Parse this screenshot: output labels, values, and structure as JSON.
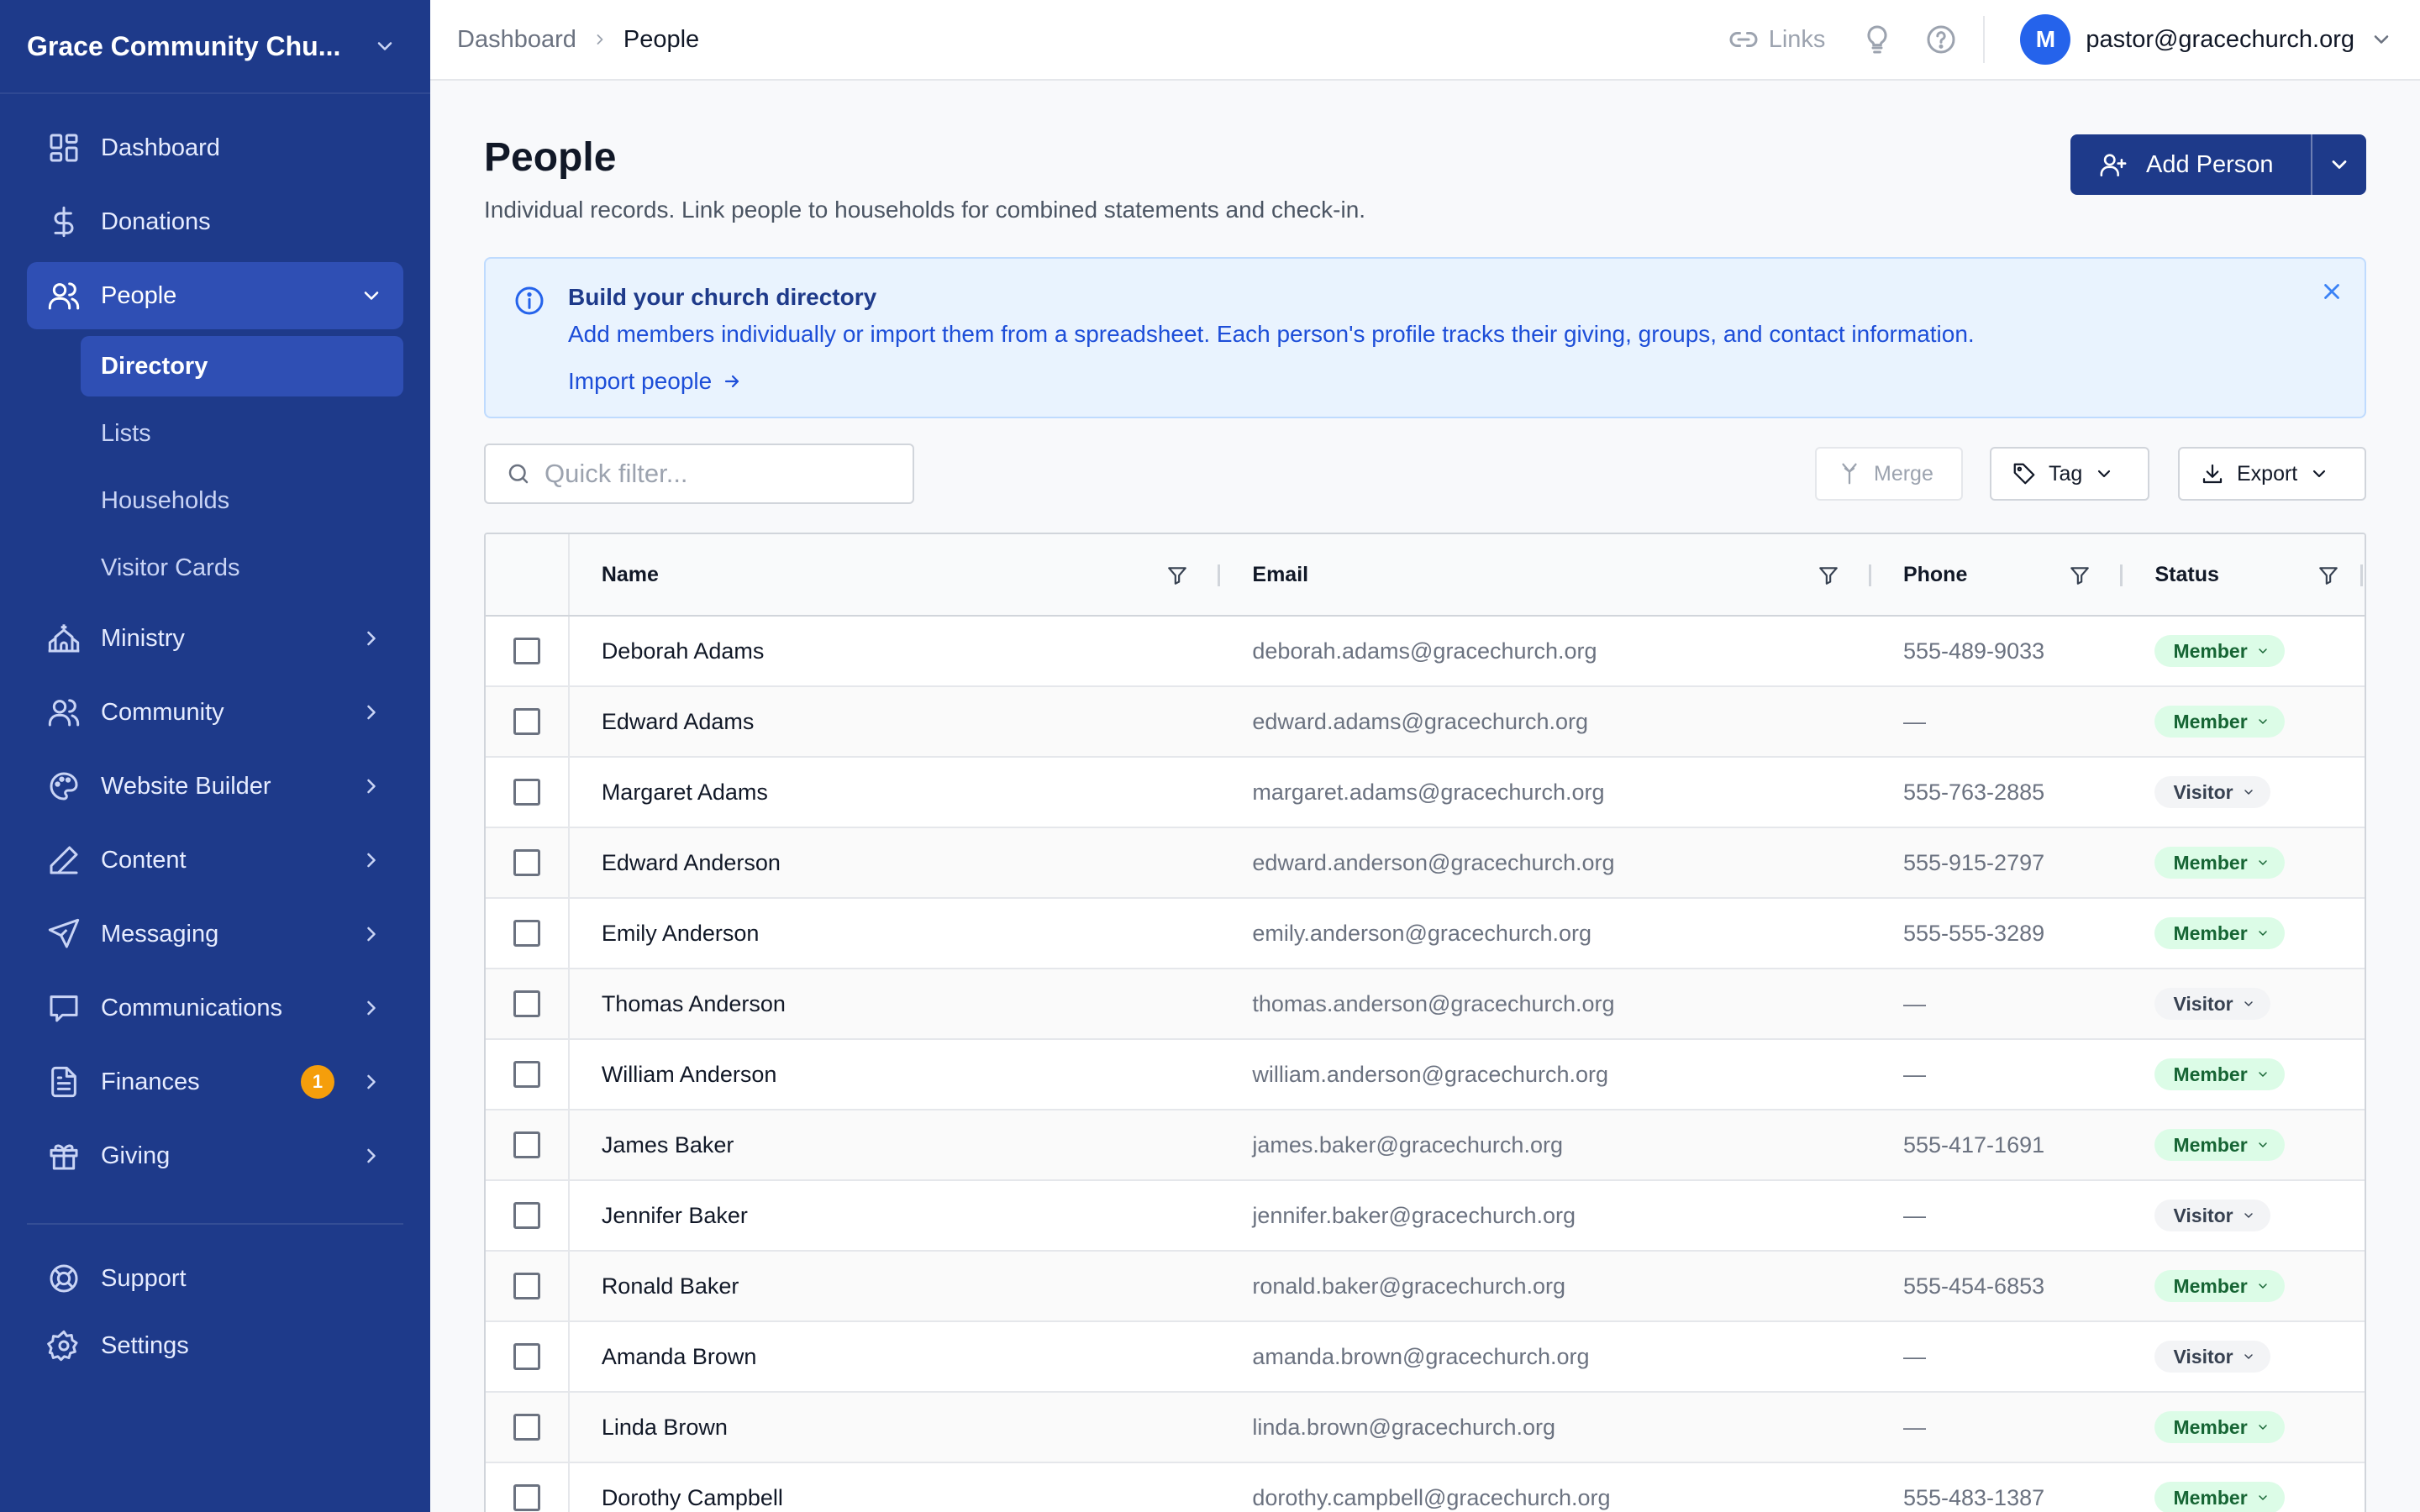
{
  "org": {
    "name": "Grace Community Chu..."
  },
  "sidebar": {
    "items": [
      {
        "label": "Dashboard",
        "icon": "grid-icon"
      },
      {
        "label": "Donations",
        "icon": "dollar-icon"
      },
      {
        "label": "People",
        "icon": "users-icon"
      },
      {
        "label": "Ministry",
        "icon": "church-icon"
      },
      {
        "label": "Community",
        "icon": "users-icon"
      },
      {
        "label": "Website Builder",
        "icon": "palette-icon"
      },
      {
        "label": "Content",
        "icon": "pen-icon"
      },
      {
        "label": "Messaging",
        "icon": "send-icon"
      },
      {
        "label": "Communications",
        "icon": "message-square-icon"
      },
      {
        "label": "Finances",
        "icon": "file-text-icon",
        "badge": "1"
      },
      {
        "label": "Giving",
        "icon": "gift-icon"
      }
    ],
    "people_sub": [
      "Directory",
      "Lists",
      "Households",
      "Visitor Cards"
    ],
    "footer": [
      {
        "label": "Support",
        "icon": "lifebuoy-icon"
      },
      {
        "label": "Settings",
        "icon": "gear-icon"
      }
    ]
  },
  "topbar": {
    "breadcrumb": [
      "Dashboard",
      "People"
    ],
    "links_label": "Links",
    "avatar_initial": "M",
    "user_email": "pastor@gracechurch.org"
  },
  "page": {
    "title": "People",
    "subtitle": "Individual records. Link people to households for combined statements and check-in.",
    "add_button": "Add Person"
  },
  "banner": {
    "title": "Build your church directory",
    "text": "Add members individually or import them from a spreadsheet. Each person's profile tracks their giving, groups, and contact information.",
    "link": "Import people"
  },
  "toolbar": {
    "filter_placeholder": "Quick filter...",
    "merge_label": "Merge",
    "tag_label": "Tag",
    "export_label": "Export"
  },
  "table": {
    "columns": [
      "Name",
      "Email",
      "Phone",
      "Status"
    ],
    "rows": [
      {
        "name": "Deborah Adams",
        "email": "deborah.adams@gracechurch.org",
        "phone": "555-489-9033",
        "status": "Member"
      },
      {
        "name": "Edward Adams",
        "email": "edward.adams@gracechurch.org",
        "phone": "—",
        "status": "Member"
      },
      {
        "name": "Margaret Adams",
        "email": "margaret.adams@gracechurch.org",
        "phone": "555-763-2885",
        "status": "Visitor"
      },
      {
        "name": "Edward Anderson",
        "email": "edward.anderson@gracechurch.org",
        "phone": "555-915-2797",
        "status": "Member"
      },
      {
        "name": "Emily Anderson",
        "email": "emily.anderson@gracechurch.org",
        "phone": "555-555-3289",
        "status": "Member"
      },
      {
        "name": "Thomas Anderson",
        "email": "thomas.anderson@gracechurch.org",
        "phone": "—",
        "status": "Visitor"
      },
      {
        "name": "William Anderson",
        "email": "william.anderson@gracechurch.org",
        "phone": "—",
        "status": "Member"
      },
      {
        "name": "James Baker",
        "email": "james.baker@gracechurch.org",
        "phone": "555-417-1691",
        "status": "Member"
      },
      {
        "name": "Jennifer Baker",
        "email": "jennifer.baker@gracechurch.org",
        "phone": "—",
        "status": "Visitor"
      },
      {
        "name": "Ronald Baker",
        "email": "ronald.baker@gracechurch.org",
        "phone": "555-454-6853",
        "status": "Member"
      },
      {
        "name": "Amanda Brown",
        "email": "amanda.brown@gracechurch.org",
        "phone": "—",
        "status": "Visitor"
      },
      {
        "name": "Linda Brown",
        "email": "linda.brown@gracechurch.org",
        "phone": "—",
        "status": "Member"
      },
      {
        "name": "Dorothy Campbell",
        "email": "dorothy.campbell@gracechurch.org",
        "phone": "555-483-1387",
        "status": "Member"
      }
    ]
  },
  "colors": {
    "sidebar_bg": "#1e3a8a",
    "sidebar_active": "#2f4fb4",
    "primary": "#1e3a8a",
    "banner_bg": "#e9f3fe",
    "member_bg": "#dcfce7",
    "member_text": "#166534",
    "badge": "#f59e0b"
  }
}
